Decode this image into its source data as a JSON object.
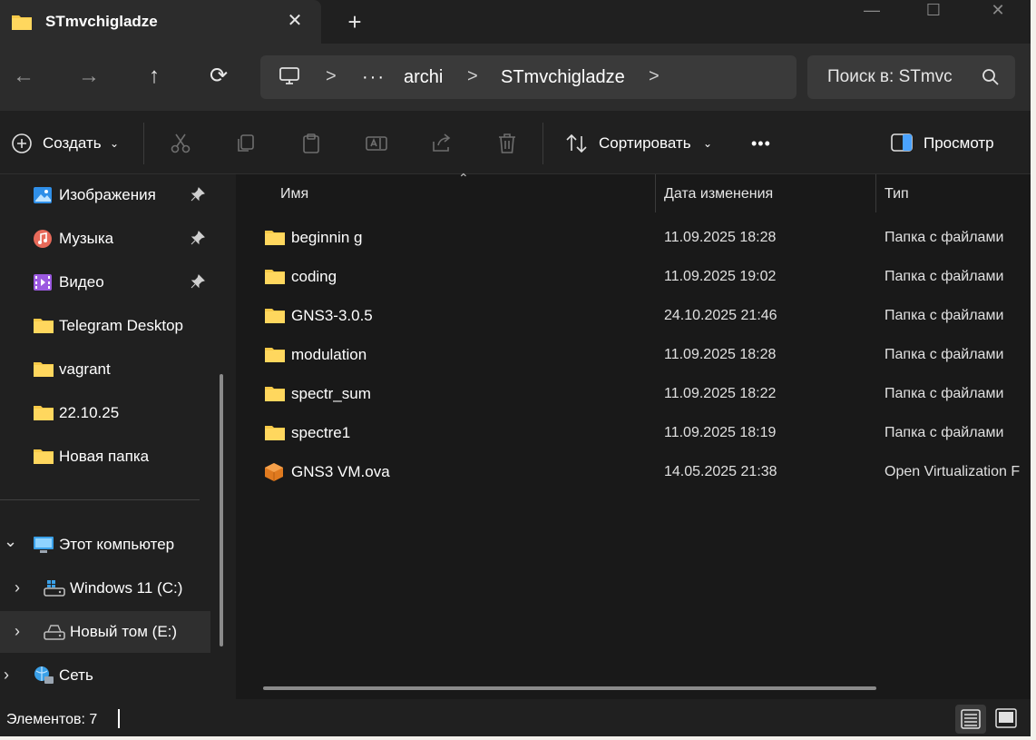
{
  "window": {
    "tab_title": "STmvchigladze",
    "tab_close": "✕",
    "new_tab": "+",
    "minimize": "—",
    "maximize": "☐",
    "close": "✕"
  },
  "nav": {
    "back": "←",
    "forward": "→",
    "up": "↑",
    "refresh": "⟳"
  },
  "address": {
    "more": "···",
    "breadcrumbs": [
      "archi",
      "STmvchigladze"
    ],
    "separator": ">"
  },
  "search": {
    "placeholder": "Поиск в: STmvc"
  },
  "commands": {
    "create": "Создать",
    "sort": "Сортировать",
    "more": "•••",
    "preview": "Просмотр"
  },
  "sidebar": {
    "quick_access": [
      {
        "label": "Изображения",
        "icon": "pictures-icon"
      },
      {
        "label": "Музыка",
        "icon": "music-icon"
      },
      {
        "label": "Видео",
        "icon": "video-icon"
      },
      {
        "label": "Telegram Desktop",
        "icon": "folder-icon"
      },
      {
        "label": "vagrant",
        "icon": "folder-icon"
      },
      {
        "label": "22.10.25",
        "icon": "folder-icon"
      },
      {
        "label": "Новая папка",
        "icon": "folder-icon"
      }
    ],
    "tree": [
      {
        "label": "Этот компьютер",
        "icon": "computer-icon"
      },
      {
        "label": "Windows 11 (C:)",
        "icon": "windows-drive-icon"
      },
      {
        "label": "Новый том (E:)",
        "icon": "drive-icon"
      },
      {
        "label": "Сеть",
        "icon": "network-icon"
      }
    ]
  },
  "columns": {
    "name": "Имя",
    "date": "Дата изменения",
    "type": "Тип"
  },
  "files": [
    {
      "name": "beginnin g",
      "date": "11.09.2025 18:28",
      "type": "Папка с файлами",
      "icon": "folder-icon"
    },
    {
      "name": "coding",
      "date": "11.09.2025 19:02",
      "type": "Папка с файлами",
      "icon": "folder-icon"
    },
    {
      "name": "GNS3-3.0.5",
      "date": "24.10.2025 21:46",
      "type": "Папка с файлами",
      "icon": "folder-icon"
    },
    {
      "name": "modulation",
      "date": "11.09.2025 18:28",
      "type": "Папка с файлами",
      "icon": "folder-icon"
    },
    {
      "name": "spectr_sum",
      "date": "11.09.2025 18:22",
      "type": "Папка с файлами",
      "icon": "folder-icon"
    },
    {
      "name": "spectre1",
      "date": "11.09.2025 18:19",
      "type": "Папка с файлами",
      "icon": "folder-icon"
    },
    {
      "name": "GNS3 VM.ova",
      "date": "14.05.2025 21:38",
      "type": "Open Virtualization F",
      "icon": "ova-package-icon"
    }
  ],
  "status": {
    "items_count": "Элементов: 7"
  },
  "colors": {
    "window_bg": "#191919",
    "chrome_bg": "#202020",
    "tab_bg": "#2c2c2c",
    "folder_yellow": "#f7c948",
    "accent_blue": "#4aa3ff"
  }
}
